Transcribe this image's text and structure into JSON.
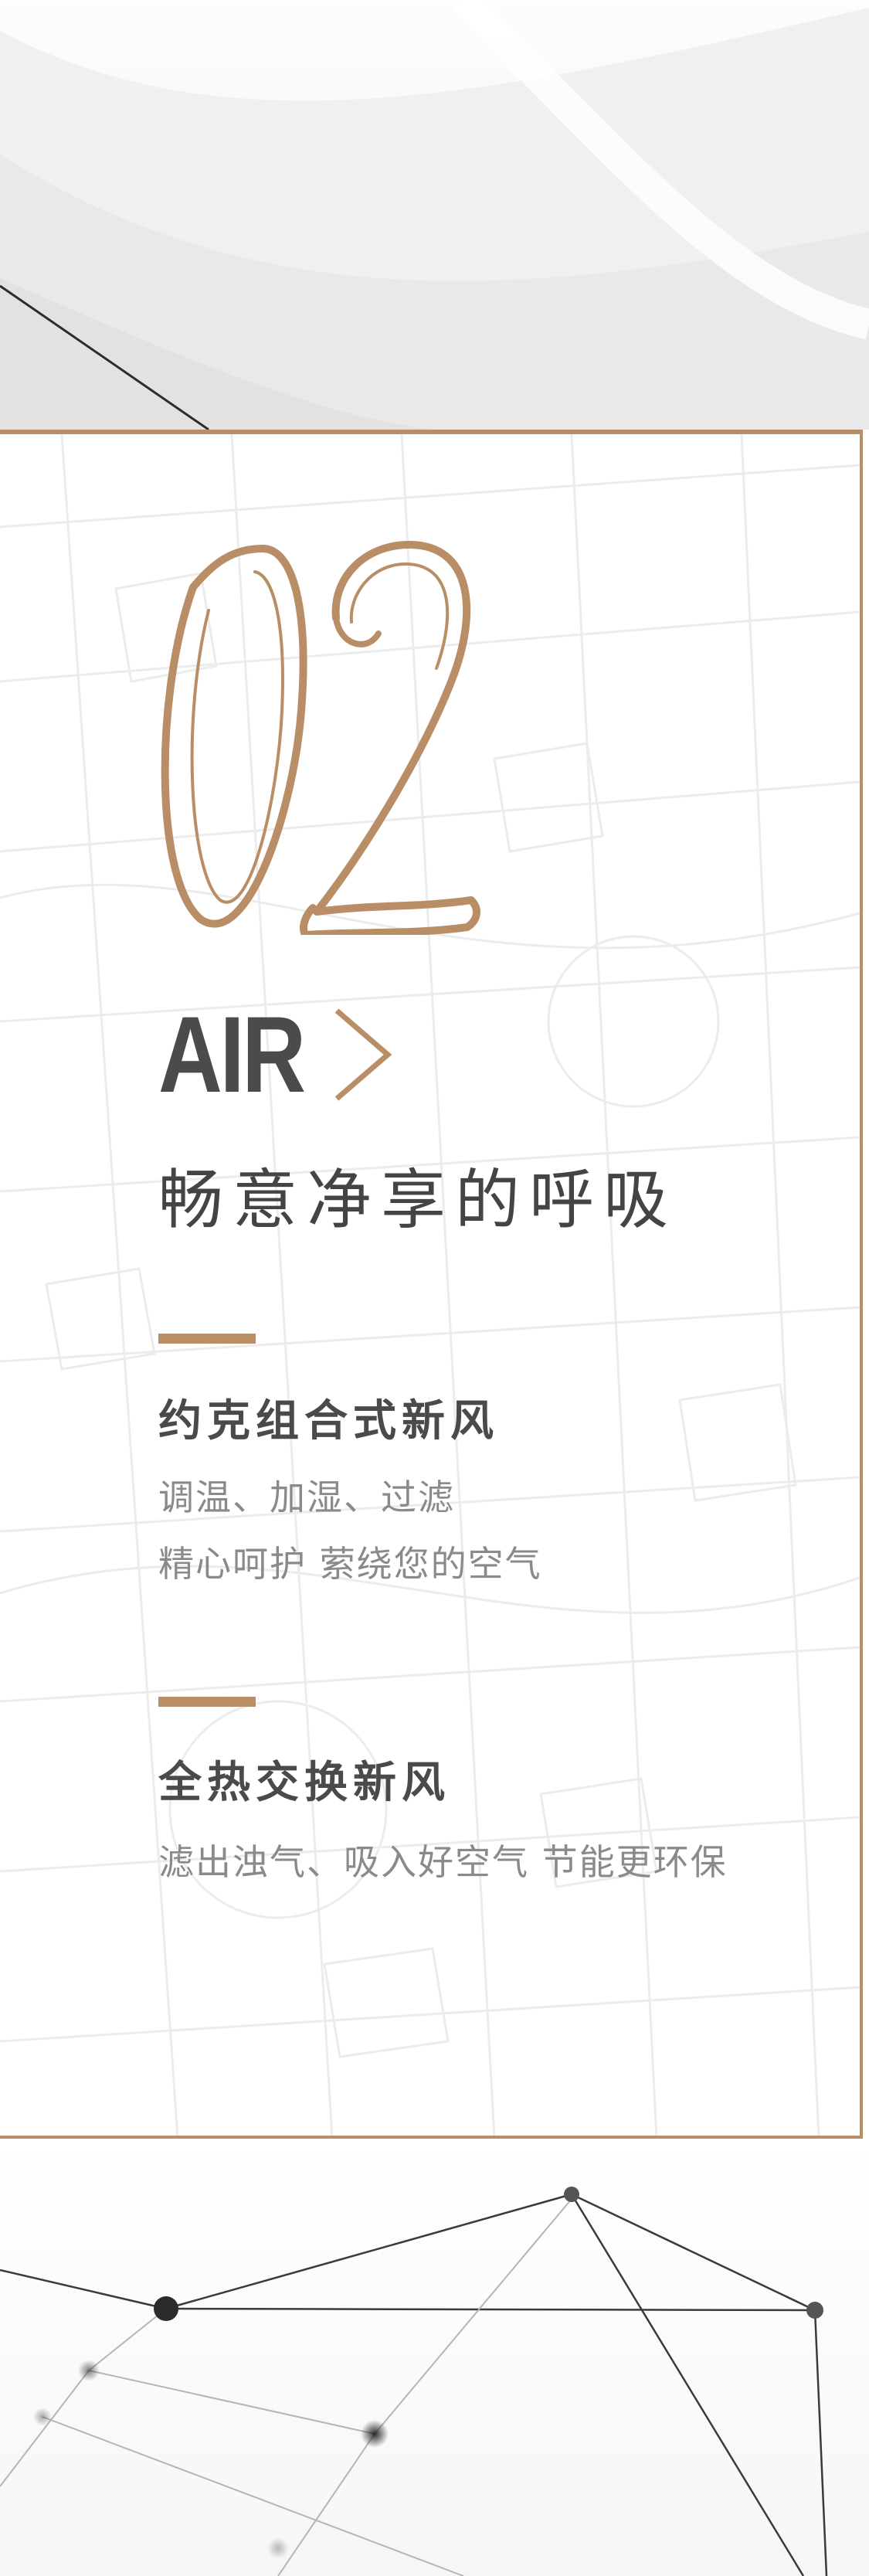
{
  "section": {
    "number": "02",
    "keyword": "AIR",
    "headline": "畅意净享的呼吸"
  },
  "features": [
    {
      "title": "约克组合式新风",
      "lines": [
        "调温、加湿、过滤",
        "精心呵护  萦绕您的空气"
      ]
    },
    {
      "title": "全热交换新风",
      "lines": [
        "滤出浊气、吸入好空气  节能更环保"
      ]
    }
  ],
  "colors": {
    "accent": "#b98e66",
    "title_text": "#4b4b4b",
    "body_text": "#8a8a8a"
  },
  "icons": {
    "chevron": "chevron-right-icon",
    "number": "decorative-number-02"
  }
}
